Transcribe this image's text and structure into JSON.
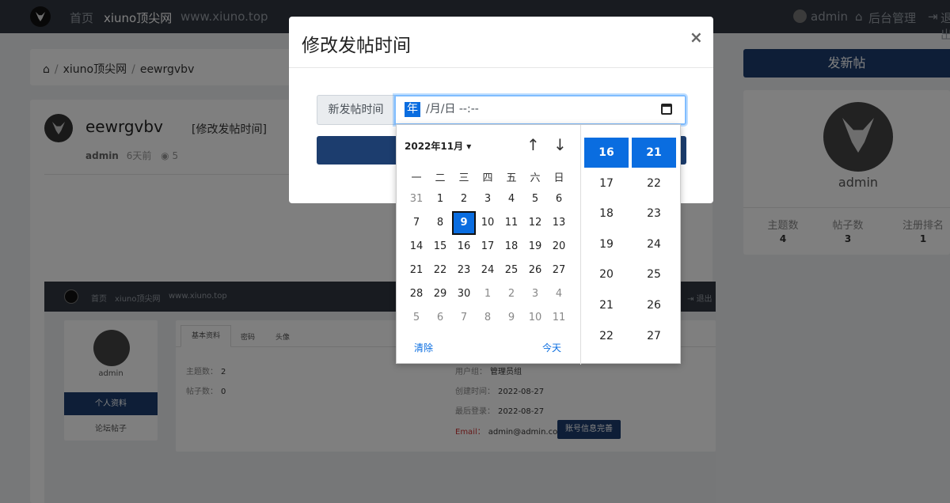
{
  "navbar": {
    "home": "首页",
    "site_name": "xiuno顶尖网",
    "site_url": "www.xiuno.top",
    "user": "admin",
    "admin_label": "后台管理",
    "logout_label": "退出"
  },
  "breadcrumb": {
    "items": [
      "xiuno顶尖网",
      "eewrgvbv"
    ]
  },
  "post": {
    "title": "eewrgvbv",
    "edit_link": "[修改发帖时间]",
    "author": "admin",
    "time": "6天前",
    "views": "5"
  },
  "embedded_screenshot": {
    "nav_home": "首页",
    "nav_site": "xiuno顶尖网",
    "nav_url": "www.xiuno.top",
    "nav_logout": "退出",
    "user": "admin",
    "side_active": "个人资料",
    "side_other": "论坛帖子",
    "tabs": [
      "基本资料",
      "密码",
      "头像"
    ],
    "threads_label": "主题数：",
    "threads_val": "2",
    "posts_label": "帖子数：",
    "posts_val": "0",
    "group_label": "用户组：",
    "group_val": "管理员组",
    "created_label": "创建时间：",
    "created_val": "2022-08-27",
    "last_label": "最后登录：",
    "last_val": "2022-08-27",
    "email_label": "Email：",
    "email_val": "admin@admin.com",
    "complete_btn": "账号信息完善"
  },
  "sidebar": {
    "new_post": "发新帖",
    "username": "admin",
    "stats": [
      {
        "label": "主题数",
        "value": "4"
      },
      {
        "label": "帖子数",
        "value": "3"
      },
      {
        "label": "注册排名",
        "value": "1"
      }
    ]
  },
  "modal": {
    "title": "修改发帖时间",
    "close": "×",
    "label": "新发帖时间",
    "input_year_seg": "年",
    "input_rest": "/月/日 --:--"
  },
  "datepicker": {
    "month_label": "2022年11月 ▾",
    "up_arrow": "↑",
    "down_arrow": "↓",
    "weekdays": [
      "一",
      "二",
      "三",
      "四",
      "五",
      "六",
      "日"
    ],
    "weeks": [
      [
        "31",
        "1",
        "2",
        "3",
        "4",
        "5",
        "6"
      ],
      [
        "7",
        "8",
        "9",
        "10",
        "11",
        "12",
        "13"
      ],
      [
        "14",
        "15",
        "16",
        "17",
        "18",
        "19",
        "20"
      ],
      [
        "21",
        "22",
        "23",
        "24",
        "25",
        "26",
        "27"
      ],
      [
        "28",
        "29",
        "30",
        "1",
        "2",
        "3",
        "4"
      ],
      [
        "5",
        "6",
        "7",
        "8",
        "9",
        "10",
        "11"
      ]
    ],
    "selected_day": "9",
    "clear": "清除",
    "today": "今天",
    "hours": [
      "16",
      "17",
      "18",
      "19",
      "20",
      "21",
      "22"
    ],
    "minutes": [
      "21",
      "22",
      "23",
      "24",
      "25",
      "26",
      "27"
    ],
    "selected_hour": "16",
    "selected_minute": "21"
  },
  "colors": {
    "primary": "#1c3d6e",
    "accent": "#0a6de0",
    "navbar": "#303641"
  }
}
